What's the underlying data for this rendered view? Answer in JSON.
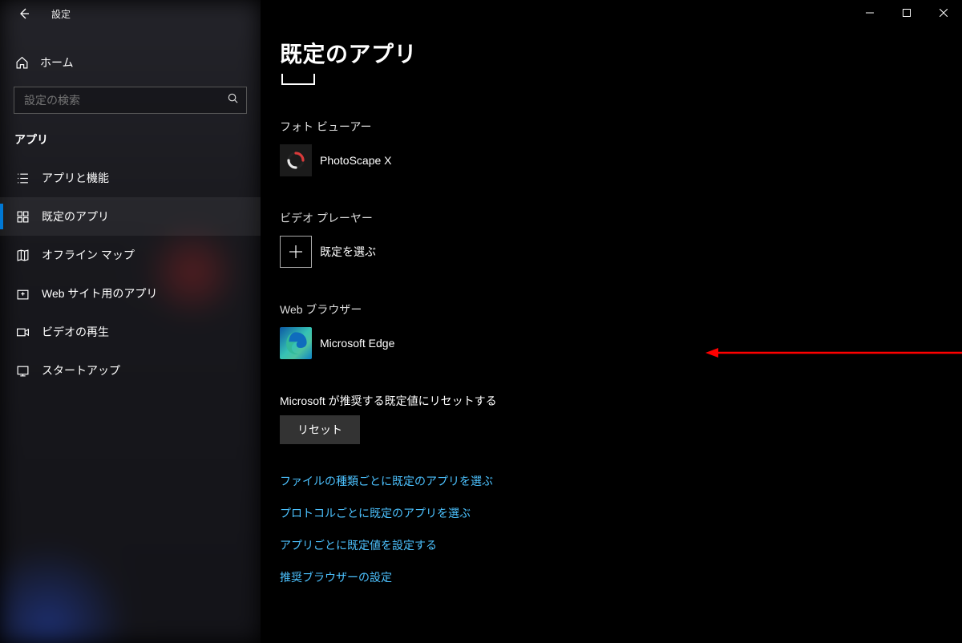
{
  "titlebar": {
    "title": "設定"
  },
  "sidebar": {
    "home": "ホーム",
    "search_placeholder": "設定の検索",
    "section": "アプリ",
    "items": [
      {
        "label": "アプリと機能"
      },
      {
        "label": "既定のアプリ"
      },
      {
        "label": "オフライン マップ"
      },
      {
        "label": "Web サイト用のアプリ"
      },
      {
        "label": "ビデオの再生"
      },
      {
        "label": "スタートアップ"
      }
    ]
  },
  "main": {
    "page_title": "既定のアプリ",
    "categories": {
      "photo": {
        "label": "フォト ビューアー",
        "app": "PhotoScape X"
      },
      "video": {
        "label": "ビデオ プレーヤー",
        "app": "既定を選ぶ"
      },
      "web": {
        "label": "Web ブラウザー",
        "app": "Microsoft Edge"
      }
    },
    "reset": {
      "label": "Microsoft が推奨する既定値にリセットする",
      "button": "リセット"
    },
    "links": [
      "ファイルの種類ごとに既定のアプリを選ぶ",
      "プロトコルごとに既定のアプリを選ぶ",
      "アプリごとに既定値を設定する",
      "推奨ブラウザーの設定"
    ]
  }
}
